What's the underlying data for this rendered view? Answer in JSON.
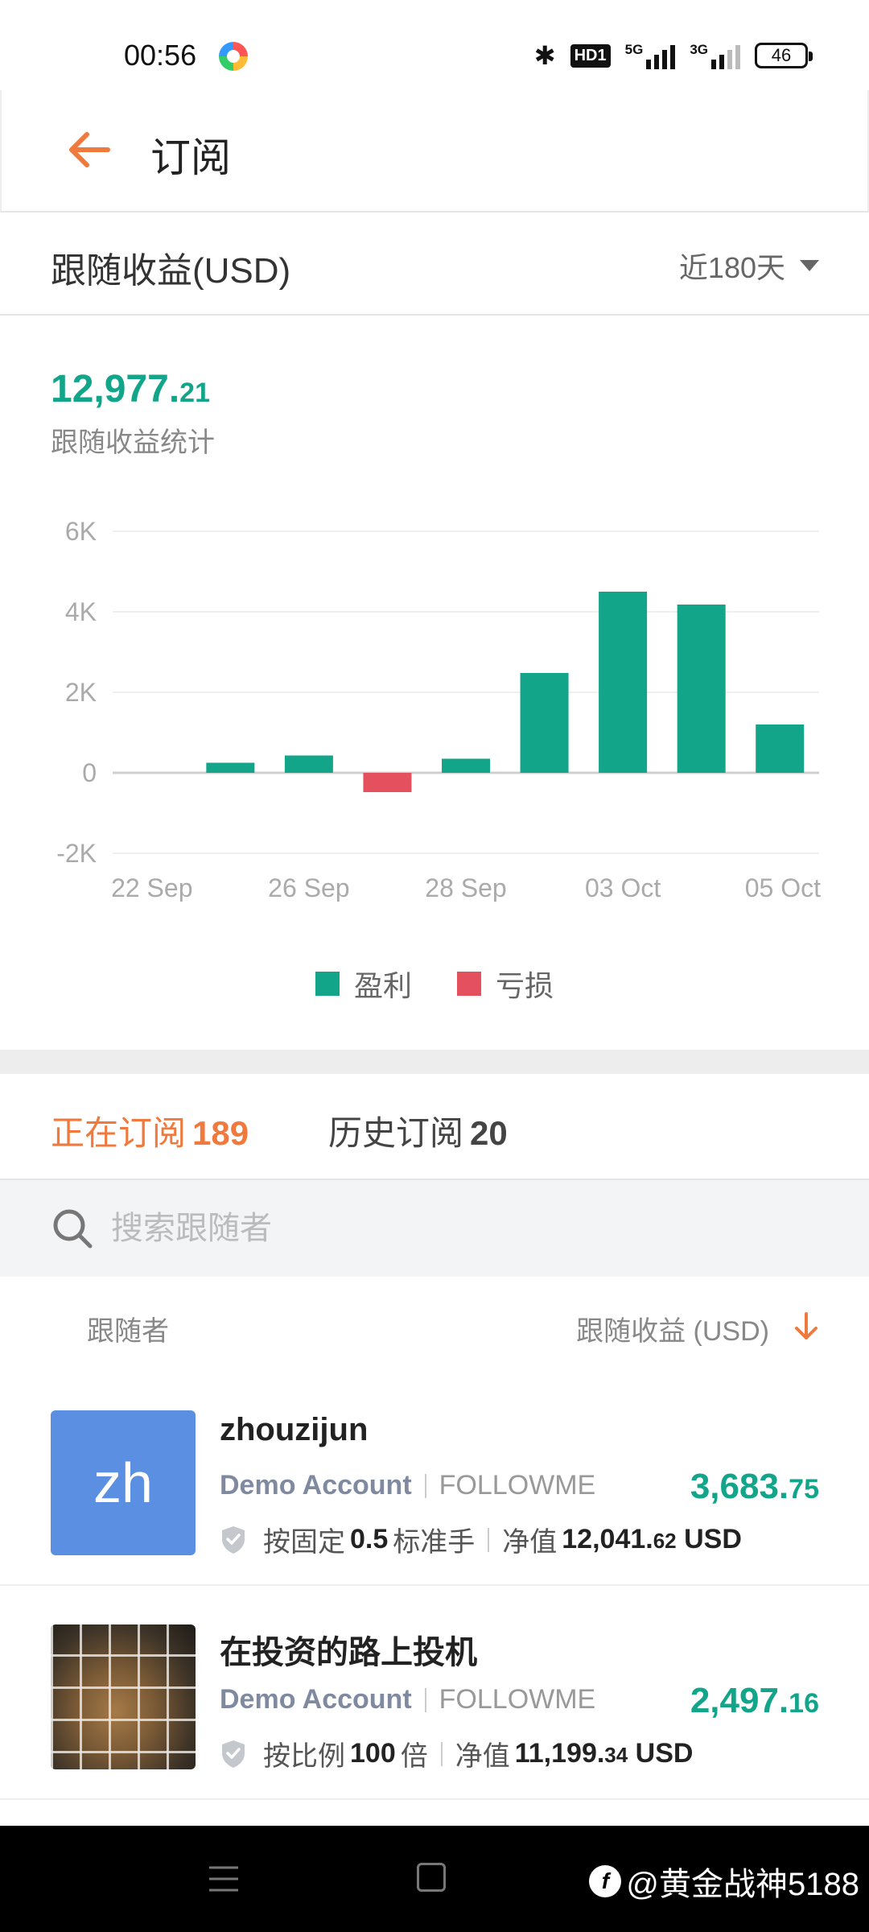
{
  "status_bar": {
    "time": "00:56",
    "battery": "46",
    "net1": "5G",
    "net2": "3G",
    "hd": "HD1"
  },
  "header": {
    "title": "订阅"
  },
  "filter": {
    "label": "跟随收益(USD)",
    "period": "近180天"
  },
  "summary": {
    "value_int": "12,977.",
    "value_dec": "21",
    "label": "跟随收益统计"
  },
  "colors": {
    "profit": "#12a58a",
    "loss": "#e5505f",
    "accent": "#f07a3e",
    "avatar_blue": "#5b8fe1"
  },
  "chart_data": {
    "type": "bar",
    "title": "",
    "xlabel": "",
    "ylabel": "",
    "ylim": [
      -2000,
      6000
    ],
    "yticks": [
      "6K",
      "4K",
      "2K",
      "0",
      "-2K"
    ],
    "ytick_values": [
      6000,
      4000,
      2000,
      0,
      -2000
    ],
    "xtick_labels": [
      "22 Sep",
      "26 Sep",
      "28 Sep",
      "03 Oct",
      "05 Oct"
    ],
    "values": [
      0,
      250,
      430,
      -480,
      350,
      2480,
      4500,
      4180,
      1200
    ],
    "grid": true,
    "legend_position": "bottom-center",
    "legend": [
      "盈利",
      "亏损"
    ]
  },
  "tabs": [
    {
      "label": "正在订阅",
      "count": "189"
    },
    {
      "label": "历史订阅",
      "count": "20"
    }
  ],
  "search": {
    "placeholder": "搜索跟随者"
  },
  "list_header": {
    "left": "跟随者",
    "right": "跟随收益 (USD)"
  },
  "items": [
    {
      "initials": "zh",
      "name": "zhouzijun",
      "account": "Demo Account",
      "broker": "FOLLOWME",
      "amount_int": "3,683.",
      "amount_dec": "75",
      "mode_prefix": "按固定",
      "mode_value": "0.5",
      "mode_suffix": "标准手",
      "nav_label": "净值",
      "nav_int": "12,041.",
      "nav_dec": "62",
      "nav_unit": "USD"
    },
    {
      "name": "在投资的路上投机",
      "account": "Demo Account",
      "broker": "FOLLOWME",
      "amount_int": "2,497.",
      "amount_dec": "16",
      "mode_prefix": "按比例",
      "mode_value": "100",
      "mode_suffix": "倍",
      "nav_label": "净值",
      "nav_int": "11,199.",
      "nav_dec": "34",
      "nav_unit": "USD"
    }
  ],
  "watermark": {
    "icon": "f",
    "text": "@黄金战神5188"
  }
}
